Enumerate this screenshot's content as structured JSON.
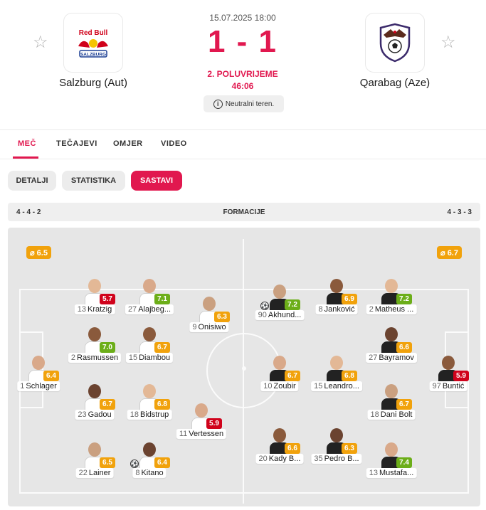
{
  "match": {
    "datetime": "15.07.2025 18:00",
    "score": "1 - 1",
    "period": "2. POLUVRIJEME",
    "clock": "46:06",
    "venue": "Neutralni teren.",
    "home": {
      "name": "Salzburg (Aut)",
      "logo": "red-bull-salzburg-logo"
    },
    "away": {
      "name": "Qarabag (Aze)",
      "logo": "qarabag-logo"
    }
  },
  "tabs": [
    {
      "label": "MEČ",
      "active": true
    },
    {
      "label": "TEČAJEVI"
    },
    {
      "label": "OMJER"
    },
    {
      "label": "VIDEO"
    }
  ],
  "subtabs": [
    {
      "label": "DETALJI"
    },
    {
      "label": "STATISTIKA"
    },
    {
      "label": "SASTAVI",
      "active": true
    }
  ],
  "formation": {
    "home": "4 - 4 - 2",
    "title": "FORMACIJE",
    "away": "4 - 3 - 3"
  },
  "averages": {
    "home": "⌀ 6.5",
    "away": "⌀ 6.7"
  },
  "colors": {
    "accent": "#e1184f",
    "rating_red": "#d0021b",
    "rating_orange": "#f1a20c",
    "rating_green": "#6cae19",
    "home_shirt": "#ffffff",
    "away_shirt": "#222222"
  },
  "players": [
    {
      "num": "1",
      "name": "Schlager",
      "rating": "6.4",
      "side": "home"
    },
    {
      "num": "2",
      "name": "Rasmussen",
      "rating": "7.0",
      "side": "home"
    },
    {
      "num": "13",
      "name": "Kratzig",
      "rating": "5.7",
      "side": "home"
    },
    {
      "num": "23",
      "name": "Gadou",
      "rating": "6.7",
      "side": "home"
    },
    {
      "num": "22",
      "name": "Lainer",
      "rating": "6.5",
      "side": "home"
    },
    {
      "num": "27",
      "name": "Alajbeg...",
      "rating": "7.1",
      "side": "home"
    },
    {
      "num": "15",
      "name": "Diambou",
      "rating": "6.7",
      "side": "home"
    },
    {
      "num": "18",
      "name": "Bidstrup",
      "rating": "6.8",
      "side": "home"
    },
    {
      "num": "8",
      "name": "Kitano",
      "rating": "6.4",
      "side": "home",
      "goal": true
    },
    {
      "num": "9",
      "name": "Onisiwo",
      "rating": "6.3",
      "side": "home"
    },
    {
      "num": "11",
      "name": "Vertessen",
      "rating": "5.9",
      "side": "home"
    },
    {
      "num": "97",
      "name": "Buntić",
      "rating": "5.9",
      "side": "away"
    },
    {
      "num": "2",
      "name": "Matheus ...",
      "rating": "7.2",
      "side": "away"
    },
    {
      "num": "27",
      "name": "Bayramov",
      "rating": "6.6",
      "side": "away"
    },
    {
      "num": "18",
      "name": "Dani Bolt",
      "rating": "6.7",
      "side": "away"
    },
    {
      "num": "13",
      "name": "Mustafa...",
      "rating": "7.4",
      "side": "away"
    },
    {
      "num": "8",
      "name": "Janković",
      "rating": "6.9",
      "side": "away"
    },
    {
      "num": "15",
      "name": "Leandro...",
      "rating": "6.8",
      "side": "away"
    },
    {
      "num": "35",
      "name": "Pedro B...",
      "rating": "6.3",
      "side": "away"
    },
    {
      "num": "90",
      "name": "Akhund...",
      "rating": "7.2",
      "side": "away",
      "goal": true
    },
    {
      "num": "10",
      "name": "Zoubir",
      "rating": "6.7",
      "side": "away"
    },
    {
      "num": "20",
      "name": "Kady B...",
      "rating": "6.6",
      "side": "away"
    }
  ]
}
